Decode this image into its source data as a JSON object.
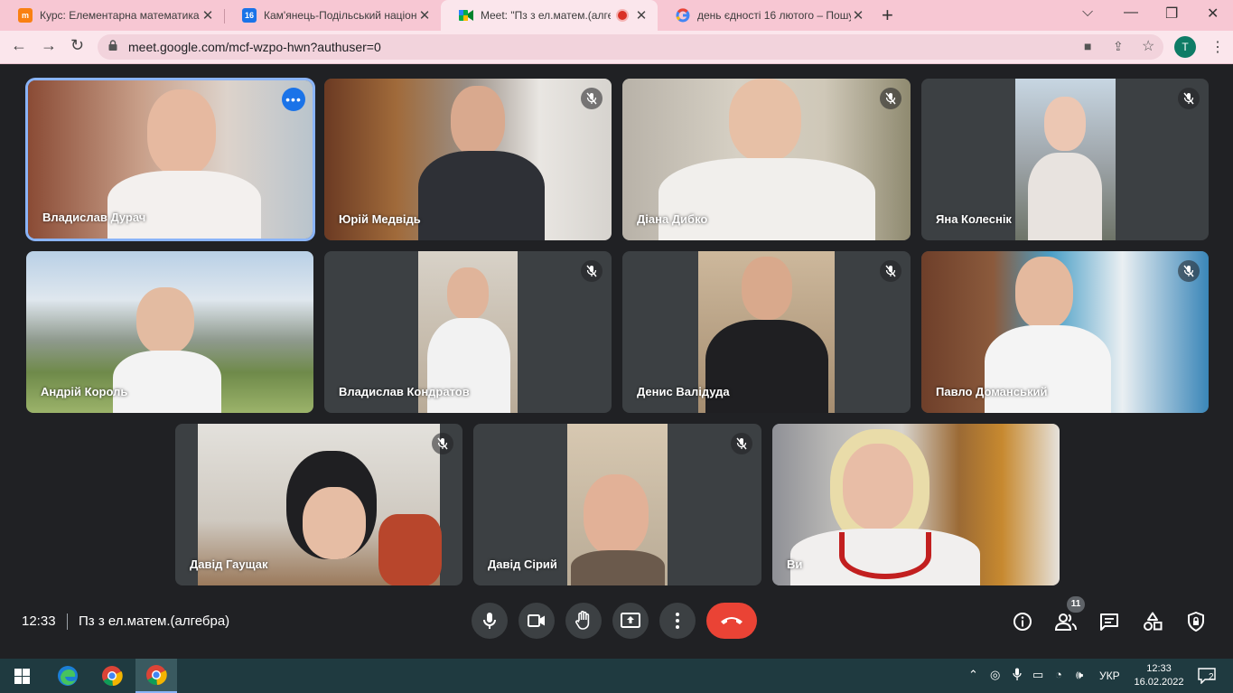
{
  "browser": {
    "tabs": [
      {
        "title": "Курс: Елементарна математика",
        "favicon": "moodle-icon",
        "active": false
      },
      {
        "title": "Кам'янець-Подільський націона",
        "favicon": "calendar-icon",
        "favicon_text": "16",
        "active": false
      },
      {
        "title": "Meet: \"Пз з ел.матем.(алгебра)",
        "favicon": "meet-icon",
        "active": true
      },
      {
        "title": "день єдності 16 лютого – Пошук",
        "favicon": "google-icon",
        "active": false
      }
    ],
    "url": "meet.google.com/mcf-wzpo-hwn?authuser=0",
    "profile_initial": "T"
  },
  "participants": [
    {
      "name": "Владислав Дурач",
      "muted": false,
      "speaking": true
    },
    {
      "name": "Юрій Медвідь",
      "muted": true
    },
    {
      "name": "Діана Дибко",
      "muted": true
    },
    {
      "name": "Яна Колеснік",
      "muted": true
    },
    {
      "name": "Андрій Король",
      "muted": false
    },
    {
      "name": "Владислав Кондратов",
      "muted": true
    },
    {
      "name": "Денис Валідуда",
      "muted": true
    },
    {
      "name": "Павло Доманський",
      "muted": true
    },
    {
      "name": "Давід Гаущак",
      "muted": true
    },
    {
      "name": "Давід Сірий",
      "muted": true
    },
    {
      "name": "Ви",
      "muted": false
    }
  ],
  "meeting": {
    "time": "12:33",
    "title": "Пз з ел.матем.(алгебра)",
    "people_count": "11"
  },
  "taskbar": {
    "language": "УКР",
    "time": "12:33",
    "date": "16.02.2022",
    "notifications": "2"
  },
  "colors": {
    "tab_strip": "#f7c7d3",
    "meet_background": "#202124",
    "tile_background": "#3c4043",
    "speaking_ring": "#8ab4f8",
    "leave_button": "#ea4335",
    "taskbar": "#1f3a40"
  }
}
